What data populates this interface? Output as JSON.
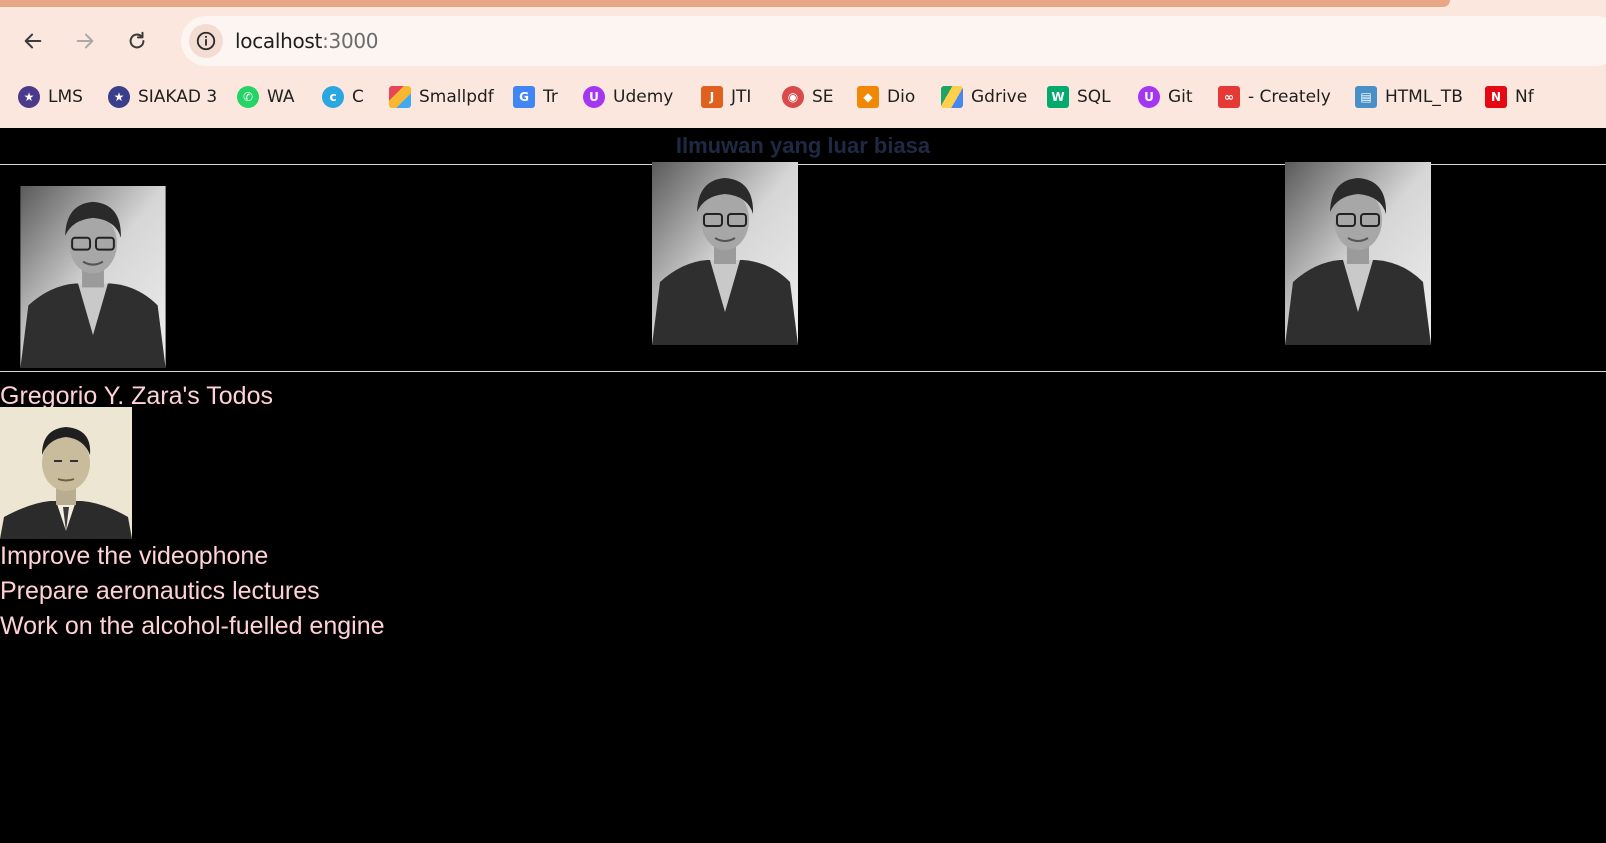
{
  "browser": {
    "url_host": "localhost",
    "url_port": ":3000",
    "bookmarks": [
      {
        "label": "LMS",
        "icon": "lms-seal-icon",
        "color": "#4b3a8c"
      },
      {
        "label": "SIAKAD 3",
        "icon": "siakad-seal-icon",
        "color": "#3a3f8c"
      },
      {
        "label": "WA",
        "icon": "whatsapp-icon",
        "color": "#25d366"
      },
      {
        "label": "C",
        "icon": "canva-icon",
        "color": "#2aa7e0"
      },
      {
        "label": "Smallpdf",
        "icon": "smallpdf-icon",
        "color": "#e8455a"
      },
      {
        "label": "Tr",
        "icon": "translate-icon",
        "color": "#4285f4"
      },
      {
        "label": "Udemy",
        "icon": "udemy-icon",
        "color": "#a435f0"
      },
      {
        "label": "JTI",
        "icon": "jti-icon",
        "color": "#e0601f"
      },
      {
        "label": "SE",
        "icon": "se-icon",
        "color": "#d94a4a"
      },
      {
        "label": "Dio",
        "icon": "drawio-icon",
        "color": "#f08705"
      },
      {
        "label": "Gdrive",
        "icon": "gdrive-icon",
        "color": "#1fa463"
      },
      {
        "label": "SQL",
        "icon": "w3schools-icon",
        "color": "#04aa6d"
      },
      {
        "label": "Git",
        "icon": "udemy-icon",
        "color": "#a435f0"
      },
      {
        "label": "- Creately",
        "icon": "creately-icon",
        "color": "#e53935"
      },
      {
        "label": "HTML_TB",
        "icon": "book-icon",
        "color": "#4a90c8"
      },
      {
        "label": "Nf",
        "icon": "netflix-icon",
        "color": "#e50914"
      }
    ]
  },
  "page": {
    "heading": "Ilmuwan yang luar biasa",
    "todos_title": "Gregorio Y. Zara's Todos",
    "todos": [
      "Improve the videophone",
      "Prepare aeronautics lectures",
      "Work on the alcohol-fuelled engine"
    ]
  },
  "colors": {
    "page_bg": "#000000",
    "heading": "#1e2a44",
    "todo_text": "#ffd1d8",
    "chrome_bg": "#fbe7dd"
  }
}
